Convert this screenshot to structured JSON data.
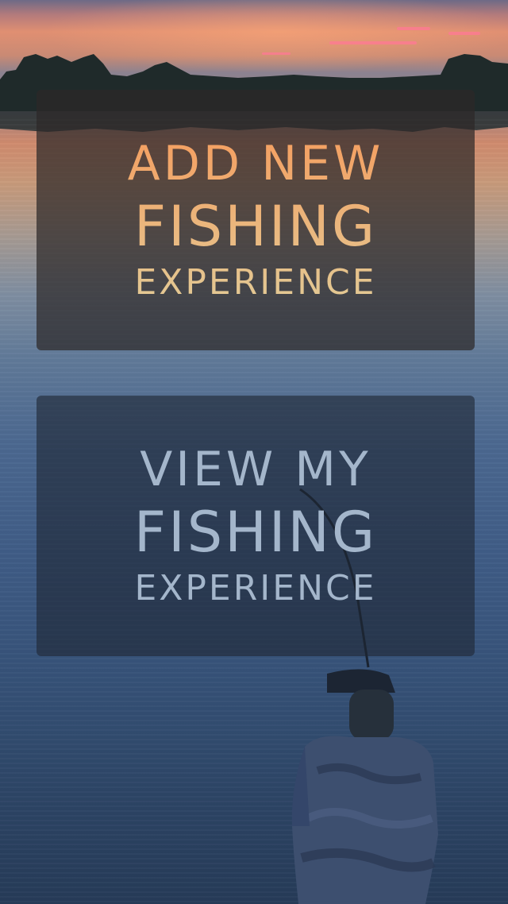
{
  "background": {
    "scene": "lake-at-sunset",
    "figure_icon": "fisherman-silhouette"
  },
  "add_card": {
    "line1": "ADD NEW",
    "line2": "FISHING",
    "line3": "EXPERIENCE",
    "text_color_top": "#f4a062",
    "text_color_bottom": "#e3c994"
  },
  "view_card": {
    "line1": "VIEW MY",
    "line2": "FISHING",
    "line3": "EXPERIENCE",
    "text_color": "#a4b6cb"
  }
}
